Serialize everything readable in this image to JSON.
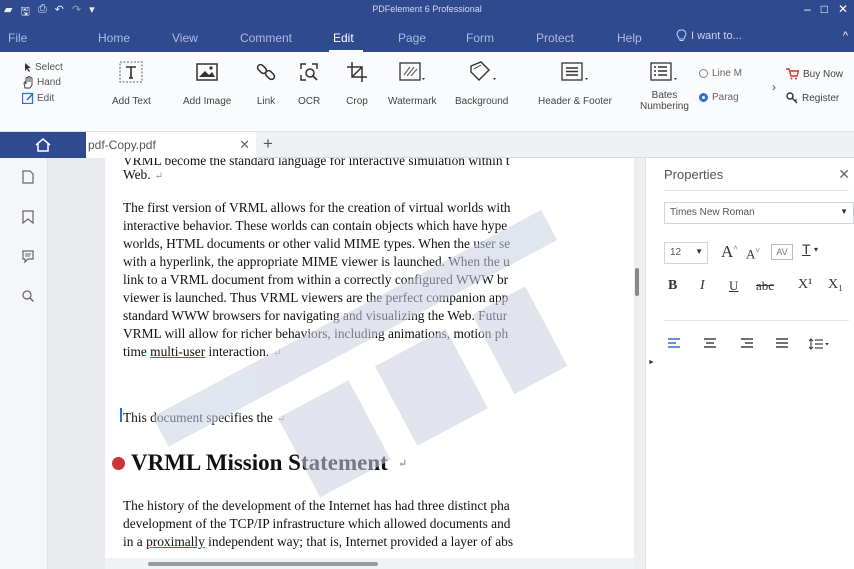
{
  "titlebar": {
    "title": "PDFelement 6 Professional",
    "quick_access": [
      "save-icon",
      "print-icon",
      "undo-icon",
      "redo-icon",
      "customize-icon"
    ],
    "window_buttons": [
      "minimize-icon",
      "restore-icon",
      "close-icon"
    ]
  },
  "menubar": {
    "items": [
      "File",
      "Home",
      "View",
      "Comment",
      "Edit",
      "Page",
      "Form",
      "Protect",
      "Help"
    ],
    "active": "Edit",
    "tell_me": "I want to..."
  },
  "ribbon": {
    "select_group": [
      "Select",
      "Hand",
      "Edit"
    ],
    "tools": [
      {
        "label": "Add Text",
        "icon": "add-text-icon"
      },
      {
        "label": "Add Image",
        "icon": "add-image-icon"
      },
      {
        "label": "Link",
        "icon": "link-icon"
      },
      {
        "label": "OCR",
        "icon": "ocr-icon"
      },
      {
        "label": "Crop",
        "icon": "crop-icon"
      },
      {
        "label": "Watermark",
        "icon": "watermark-icon"
      },
      {
        "label": "Background",
        "icon": "background-icon"
      },
      {
        "label": "Header & Footer",
        "icon": "header-footer-icon"
      },
      {
        "label": "Bates\nNumbering",
        "icon": "bates-numbering-icon"
      }
    ],
    "radio_options": [
      "Line M",
      "Parag"
    ],
    "radio_selected": "Parag",
    "right_actions": [
      "Buy Now",
      "Register"
    ]
  },
  "tabs": {
    "document": "pdf-Copy.pdf"
  },
  "document": {
    "lines_top_partial": "VRML become the standard language for interactive simulation within t",
    "line_web": "Web.",
    "paragraph1": [
      "The first version of VRML allows for the creation of virtual worlds with",
      "interactive behavior. These worlds can contain objects which have hype",
      "worlds, HTML documents or other valid MIME types. When the user se",
      "with a hyperlink, the appropriate MIME viewer is launched. When the u",
      "link to a VRML document from within a correctly configured WWW br",
      "viewer is launched. Thus VRML viewers are the perfect companion app",
      "standard WWW browsers for navigating and visualizing the Web. Futur",
      "VRML will allow for richer behaviors, including animations, motion ph"
    ],
    "last_line_prefix": "time ",
    "last_line_underlined": "multi-user",
    "last_line_suffix": " interaction.",
    "line_specifies": "This document specifies the",
    "heading": "VRML Mission Statement",
    "paragraph2": [
      "The history of the development of the Internet has had three distinct pha",
      "development of the TCP/IP infrastructure which allowed documents and"
    ],
    "p2_line3_prefix": "in a ",
    "p2_line3_underlined": "proximally",
    "p2_line3_suffix": " independent way; that is, Internet provided a layer of abs",
    "paragraph_mark": "↵"
  },
  "properties": {
    "title": "Properties",
    "font_family": "Times New Roman",
    "font_size": "12",
    "format_buttons": [
      "B",
      "I",
      "U",
      "abc",
      "X¹",
      "X₁"
    ],
    "size_buttons": [
      "A˄",
      "A˅"
    ]
  },
  "colors": {
    "brand_blue": "#2f4a8f",
    "accent_blue": "#2d6fd6",
    "heading_bullet": "#cc3333"
  }
}
